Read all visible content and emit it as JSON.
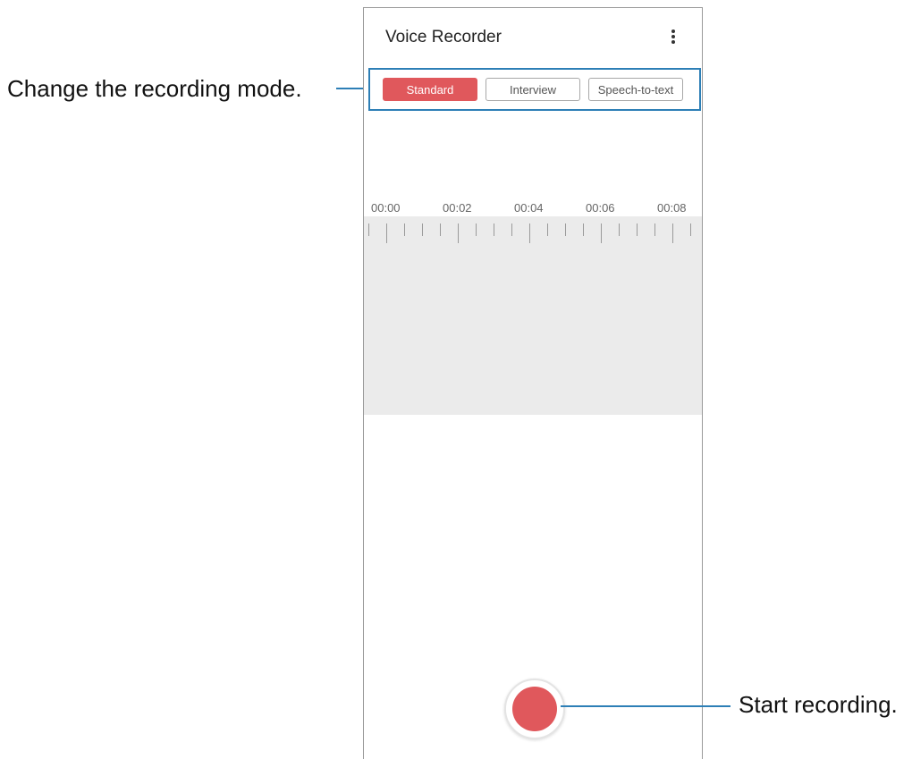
{
  "app": {
    "title": "Voice Recorder",
    "menu_icon": "more-vertical-icon"
  },
  "modes": [
    {
      "label": "Standard",
      "selected": true
    },
    {
      "label": "Interview",
      "selected": false
    },
    {
      "label": "Speech-to-text",
      "selected": false
    }
  ],
  "timeline": {
    "labels": [
      "00:00",
      "00:02",
      "00:04",
      "00:06",
      "00:08"
    ]
  },
  "record": {
    "icon": "record-icon"
  },
  "callouts": {
    "mode": "Change the recording mode.",
    "record": "Start recording."
  },
  "colors": {
    "accent": "#e0585c",
    "callout_line": "#2d7fb6",
    "wave_bg": "#ebebeb"
  }
}
